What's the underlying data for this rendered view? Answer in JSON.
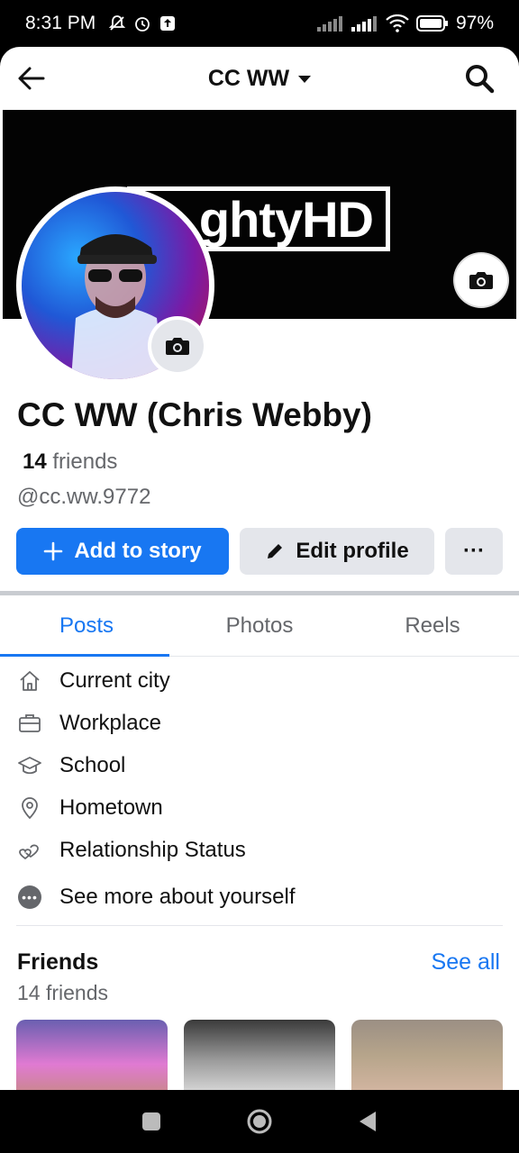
{
  "status_bar": {
    "time": "8:31 PM",
    "battery": "97%",
    "icons": [
      "mute-bell-icon",
      "alarm-icon",
      "upload-icon",
      "signal-icon",
      "signal-icon",
      "wifi-icon",
      "battery-icon"
    ]
  },
  "header": {
    "title": "CC WW",
    "back_icon": "back-arrow-icon",
    "search_icon": "search-icon"
  },
  "cover": {
    "banner_text": "ghtyHD",
    "camera_icon": "camera-icon"
  },
  "profile": {
    "name": "CC WW (Chris Webby)",
    "friends_count": "14",
    "friends_label": "friends",
    "username": "@cc.ww.9772"
  },
  "actions": {
    "add_story": "Add to story",
    "edit_profile": "Edit profile",
    "more": "···"
  },
  "tabs": [
    "Posts",
    "Photos",
    "Reels"
  ],
  "details": [
    {
      "icon": "home-icon",
      "label": "Current city"
    },
    {
      "icon": "briefcase-icon",
      "label": "Workplace"
    },
    {
      "icon": "graduation-cap-icon",
      "label": "School"
    },
    {
      "icon": "location-pin-icon",
      "label": "Hometown"
    },
    {
      "icon": "hearts-icon",
      "label": "Relationship Status"
    },
    {
      "icon": "more-dots-icon",
      "label": "See more about yourself"
    }
  ],
  "friends_section": {
    "title": "Friends",
    "count_label": "14 friends",
    "see_all": "See all"
  },
  "colors": {
    "accent": "#1877f2",
    "secondary_text": "#65676b",
    "button_gray": "#e4e6eb"
  }
}
